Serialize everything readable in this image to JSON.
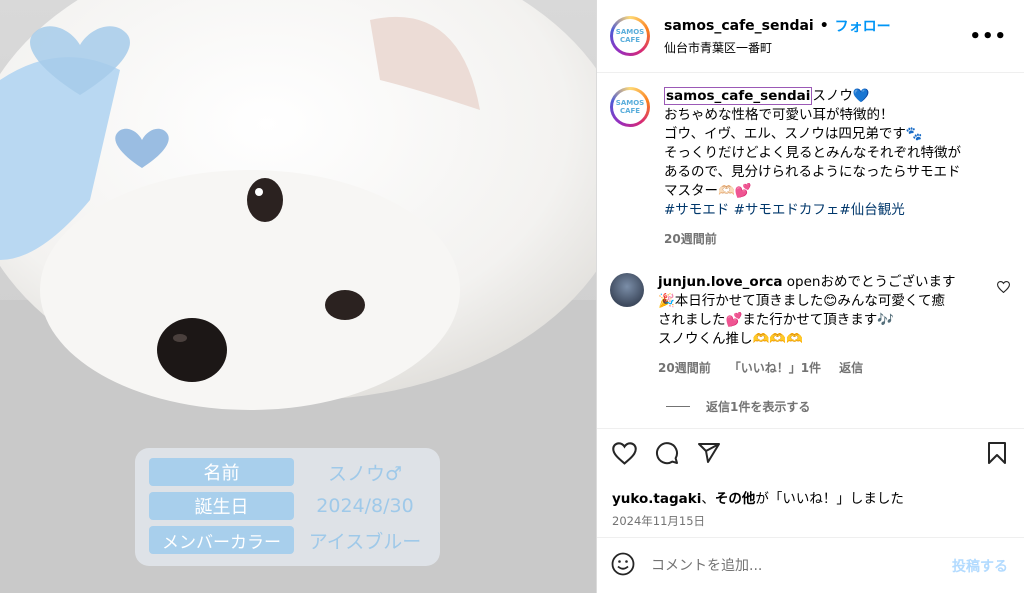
{
  "post": {
    "username": "samos_cafe_sendai",
    "follow_label": "フォロー",
    "location": "仙台市青葉区一番町",
    "avatar_text": "SAMOS CAFE",
    "more_label": "•••"
  },
  "photo": {
    "info": [
      {
        "label": "名前",
        "value": "スノウ♂"
      },
      {
        "label": "誕生日",
        "value": "2024/8/30"
      },
      {
        "label": "メンバーカラー",
        "value": "アイスブルー"
      }
    ]
  },
  "caption": {
    "username": "samos_cafe_sendai",
    "line1": "スノウ💙",
    "line2": "おちゃめな性格で可愛い耳が特徴的！",
    "line3": "ゴウ、イヴ、エル、スノウは四兄弟です🐾",
    "line4": "そっくりだけどよく見るとみんなそれぞれ特徴が",
    "line5": "あるので、見分けられるようになったらサモエド",
    "line6": "マスター🫶🏻💕",
    "hashtags": "#サモエド #サモエドカフェ#仙台観光",
    "time": "20週間前"
  },
  "comment": {
    "username": "junjun.love_orca",
    "line1": "openおめでとうございます",
    "line2": "🎉本日行かせて頂きました😊みんな可愛くて癒",
    "line3": "されました💕また行かせて頂きます🎶",
    "line4": "スノウくん推し🫶🫶🫶",
    "time": "20週間前",
    "likes": "「いいね！」1件",
    "reply": "返信",
    "show_replies": "返信1件を表示する"
  },
  "actions": {
    "liked_by_user": "yuko.tagaki",
    "liked_by_others": "その他",
    "liked_suffix": "が「いいね！」しました",
    "liked_sep": "、",
    "date": "2024年11月15日"
  },
  "add_comment": {
    "placeholder": "コメントを追加...",
    "post_label": "投稿する"
  },
  "colors": {
    "accent": "#0095f6",
    "member_color": "#a8cfec"
  }
}
